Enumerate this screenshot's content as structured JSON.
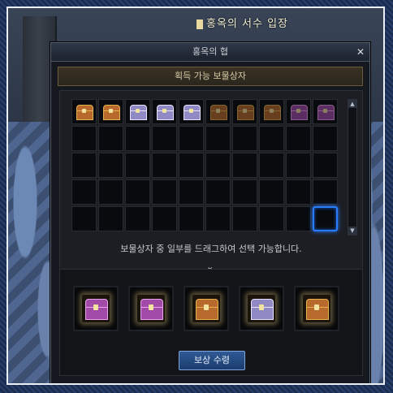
{
  "background": {
    "sign_text": "홍옥의 서수 입장"
  },
  "window": {
    "title": "홍옥의 협",
    "close_icon": "✕"
  },
  "section": {
    "header": "획득 가능 보물상자"
  },
  "grid": {
    "rows": 5,
    "cols": 10,
    "chests": [
      "orange",
      "orange",
      "silver",
      "silver",
      "silver",
      "orange-dim",
      "orange-dim",
      "orange-dim",
      "pink-dim",
      "pink-dim"
    ],
    "selected_cell": 49
  },
  "hint_text": "보물상자 중 일부를 드래그하여 선택 가능합니다.",
  "chevron": "⌄",
  "rewards": {
    "slots": [
      "pink",
      "pink",
      "orange",
      "silver",
      "orange"
    ],
    "claim_button": "보상 수령"
  },
  "colors": {
    "selected_highlight": "#2a7cff",
    "button": "#2f5a95"
  }
}
